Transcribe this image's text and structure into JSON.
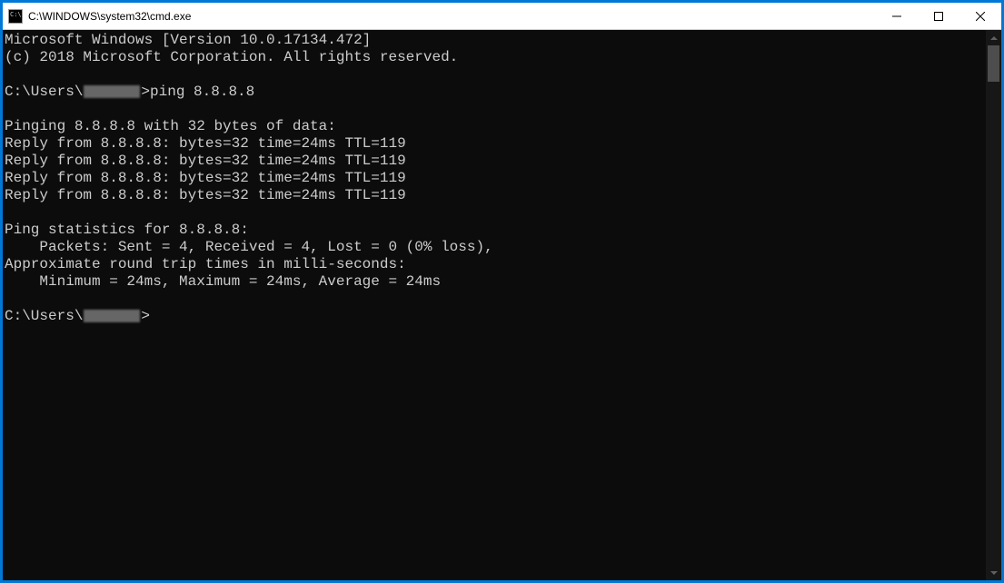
{
  "window": {
    "title": "C:\\WINDOWS\\system32\\cmd.exe"
  },
  "terminal": {
    "header1": "Microsoft Windows [Version 10.0.17134.472]",
    "header2": "(c) 2018 Microsoft Corporation. All rights reserved.",
    "blank": "",
    "prompt_prefix": "C:\\Users\\",
    "prompt_suffix": ">",
    "command": "ping 8.8.8.8",
    "pinging": "Pinging 8.8.8.8 with 32 bytes of data:",
    "replies": [
      "Reply from 8.8.8.8: bytes=32 time=24ms TTL=119",
      "Reply from 8.8.8.8: bytes=32 time=24ms TTL=119",
      "Reply from 8.8.8.8: bytes=32 time=24ms TTL=119",
      "Reply from 8.8.8.8: bytes=32 time=24ms TTL=119"
    ],
    "stats_header": "Ping statistics for 8.8.8.8:",
    "stats_packets": "    Packets: Sent = 4, Received = 4, Lost = 0 (0% loss),",
    "rtt_header": "Approximate round trip times in milli-seconds:",
    "rtt_values": "    Minimum = 24ms, Maximum = 24ms, Average = 24ms"
  }
}
